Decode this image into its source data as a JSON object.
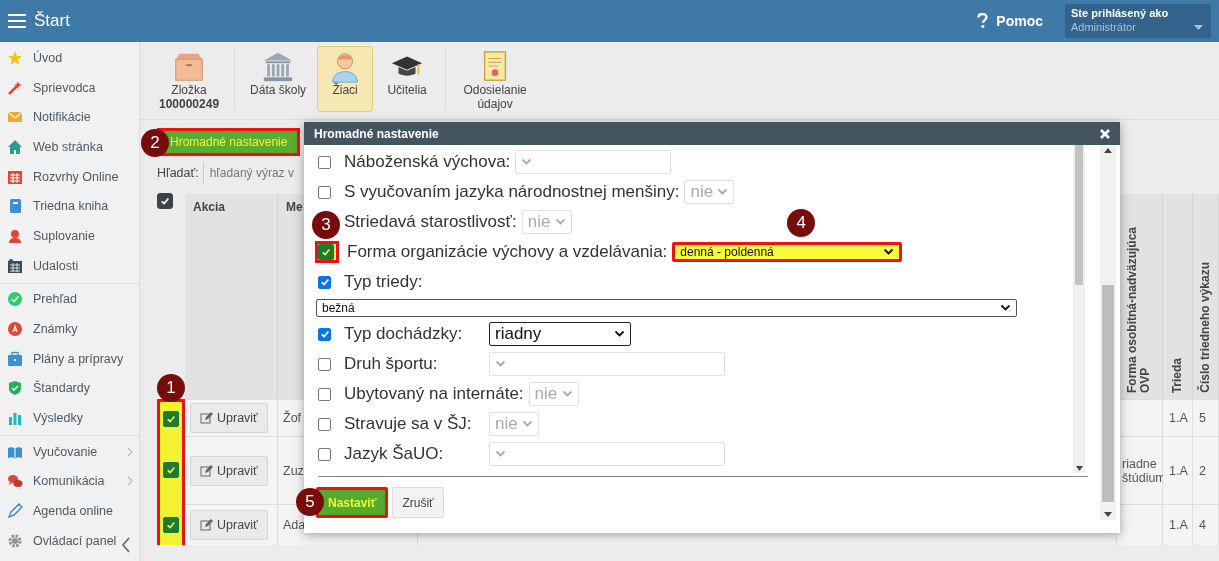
{
  "top_bar": {
    "title": "Štart",
    "help": "Pomoc",
    "user_caption": "Ste prihlásený ako",
    "user_name": "Administrátor"
  },
  "sidebar": {
    "groups": [
      [
        {
          "label": "Úvod",
          "has_submenu": false
        },
        {
          "label": "Sprievodca",
          "has_submenu": false
        },
        {
          "label": "Notifikácie",
          "has_submenu": false
        },
        {
          "label": "Web stránka",
          "has_submenu": false
        },
        {
          "label": "Rozvrhy Online",
          "has_submenu": false
        },
        {
          "label": "Triedna kniha",
          "has_submenu": false
        },
        {
          "label": "Suplovanie",
          "has_submenu": false
        },
        {
          "label": "Udalosti",
          "has_submenu": false
        }
      ],
      [
        {
          "label": "Prehľad",
          "has_submenu": false
        },
        {
          "label": "Známky",
          "has_submenu": false
        },
        {
          "label": "Plány a prípravy",
          "has_submenu": false
        },
        {
          "label": "Štandardy",
          "has_submenu": false
        },
        {
          "label": "Výsledky",
          "has_submenu": false
        }
      ],
      [
        {
          "label": "Vyučovanie",
          "has_submenu": true
        },
        {
          "label": "Komunikácia",
          "has_submenu": true
        },
        {
          "label": "Agenda online",
          "has_submenu": false
        },
        {
          "label": "Ovládací panel",
          "has_submenu": false
        }
      ]
    ]
  },
  "toolbar": {
    "groups": [
      [
        {
          "label": "Zložka",
          "sublabel": "100000249",
          "selected": false
        }
      ],
      [
        {
          "label": "Dáta školy",
          "selected": false
        },
        {
          "label": "Žiaci",
          "selected": true
        },
        {
          "label": "Učitelia",
          "selected": false
        }
      ],
      [
        {
          "label": "Odosielanie údajov",
          "selected": false
        }
      ]
    ]
  },
  "bulk_button": {
    "label": "Hromadné nastavenie",
    "highlighted": true,
    "callout": "2"
  },
  "search": {
    "label": "Hľadať:",
    "placeholder": "hľadaný výraz v"
  },
  "table": {
    "select_all": true,
    "selection_highlighted": true,
    "callout": "1",
    "columns": {
      "action": "Akcia",
      "name": "Me",
      "forma_ovp": "Forma osobitná-nadväzujúca OVP",
      "trieda": "Trieda",
      "cislo_vykazu": "Číslo triedneho výkazu"
    },
    "rows": [
      {
        "checked": true,
        "action": "Upraviť",
        "name": "Žof",
        "trieda": "1.A",
        "cislo_vykazu": "5"
      },
      {
        "checked": true,
        "action": "Upraviť",
        "name": "Zuz",
        "forma_ovp": "riadne štúdium",
        "trieda": "1.A",
        "cislo_vykazu": "2"
      },
      {
        "checked": true,
        "action": "Upraviť",
        "name": "Ada",
        "trieda": "1.A",
        "cislo_vykazu": "4"
      }
    ]
  },
  "dialog": {
    "title": "Hromadné nastavenie",
    "fields": [
      {
        "kind": "inline",
        "checked": false,
        "highlighted": false,
        "label": "Náboženská výchova:",
        "select": {
          "disabled": true
        }
      },
      {
        "kind": "inline",
        "checked": false,
        "highlighted": false,
        "label": "S vyučovaním jazyka národnostnej menšiny:",
        "select": {
          "value": "nie",
          "disabled": true
        }
      },
      {
        "kind": "inline",
        "highlighted": false,
        "label": "Striedavá starostlivosť:",
        "select": {
          "value": "nie",
          "disabled": true
        }
      },
      {
        "kind": "inline",
        "checked": true,
        "highlighted": true,
        "callout": "3",
        "label": "Forma organizácie výchovy a vzdelávania:",
        "select": {
          "value": "denná - poldenná",
          "disabled": false,
          "callout": "4"
        }
      },
      {
        "kind": "stacked",
        "checked": true,
        "highlighted": false,
        "label": "Typ triedy:",
        "select": {
          "value": "bežná",
          "disabled": false
        }
      },
      {
        "kind": "column",
        "checked": true,
        "highlighted": false,
        "label": "Typ dochádzky:",
        "select": {
          "value": "riadny",
          "disabled": false
        }
      },
      {
        "kind": "column",
        "checked": false,
        "highlighted": false,
        "label": "Druh športu:",
        "select": {
          "disabled": true
        }
      },
      {
        "kind": "inline",
        "checked": false,
        "highlighted": false,
        "label": "Ubytovaný na internáte:",
        "select": {
          "value": "nie",
          "disabled": true
        }
      },
      {
        "kind": "column",
        "checked": false,
        "highlighted": false,
        "label": "Stravuje sa v ŠJ:",
        "select": {
          "value": "nie",
          "disabled": true
        }
      },
      {
        "kind": "column",
        "checked": false,
        "highlighted": false,
        "label": "Jazyk ŠaUO:",
        "select": {
          "disabled": true
        }
      }
    ],
    "buttons": [
      {
        "kind": "primary",
        "label": "Nastaviť",
        "highlighted": true,
        "callout": "5"
      },
      {
        "kind": "default",
        "label": "Zrušiť",
        "highlighted": false
      }
    ]
  }
}
